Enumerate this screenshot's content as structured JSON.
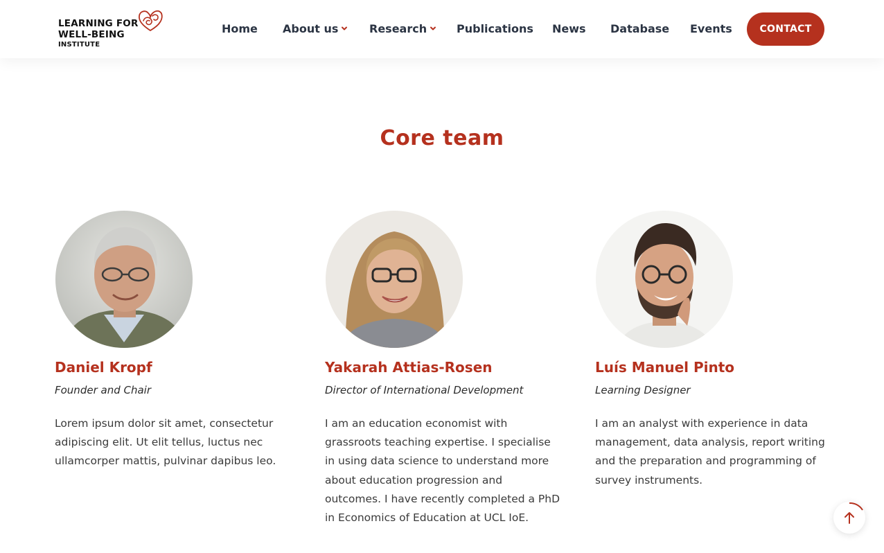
{
  "header": {
    "logo": {
      "line1": "LEARNING FOR",
      "line2": "WELL-BEING",
      "line3": "INSTITUTE"
    },
    "nav": [
      {
        "label": "Home",
        "has_dropdown": false
      },
      {
        "label": "About us",
        "has_dropdown": true
      },
      {
        "label": "Research",
        "has_dropdown": true
      },
      {
        "label": "Publications",
        "has_dropdown": false
      },
      {
        "label": "News",
        "has_dropdown": false
      },
      {
        "label": "Database",
        "has_dropdown": false
      },
      {
        "label": "Events",
        "has_dropdown": false
      }
    ],
    "contact_label": "CONTACT"
  },
  "section": {
    "title": "Core team"
  },
  "team": [
    {
      "name": "Daniel Kropf",
      "role": "Founder and Chair",
      "bio": "Lorem ipsum dolor sit amet, consectetur adipiscing elit. Ut elit tellus, luctus nec ullamcorper mattis, pulvinar dapibus leo.",
      "photo_icon": "portrait-daniel"
    },
    {
      "name": "Yakarah Attias-Rosen",
      "role": "Director of International Development",
      "bio": "I am an education economist with grassroots teaching expertise. I specialise in using data science to understand more about education progression and outcomes. I have recently completed a PhD in Economics of Education at UCL IoE.",
      "photo_icon": "portrait-yakarah"
    },
    {
      "name": "Luís Manuel Pinto",
      "role": "Learning Designer",
      "bio": "I am an analyst with experience in data management, data analysis, report writing and the preparation and programming of survey instruments.",
      "photo_icon": "portrait-luis"
    }
  ],
  "scroll_top": {
    "icon": "arrow-up-icon"
  },
  "colors": {
    "accent": "#b5311e",
    "nav_text": "#2b3443",
    "body_text": "#3a3a3a"
  }
}
